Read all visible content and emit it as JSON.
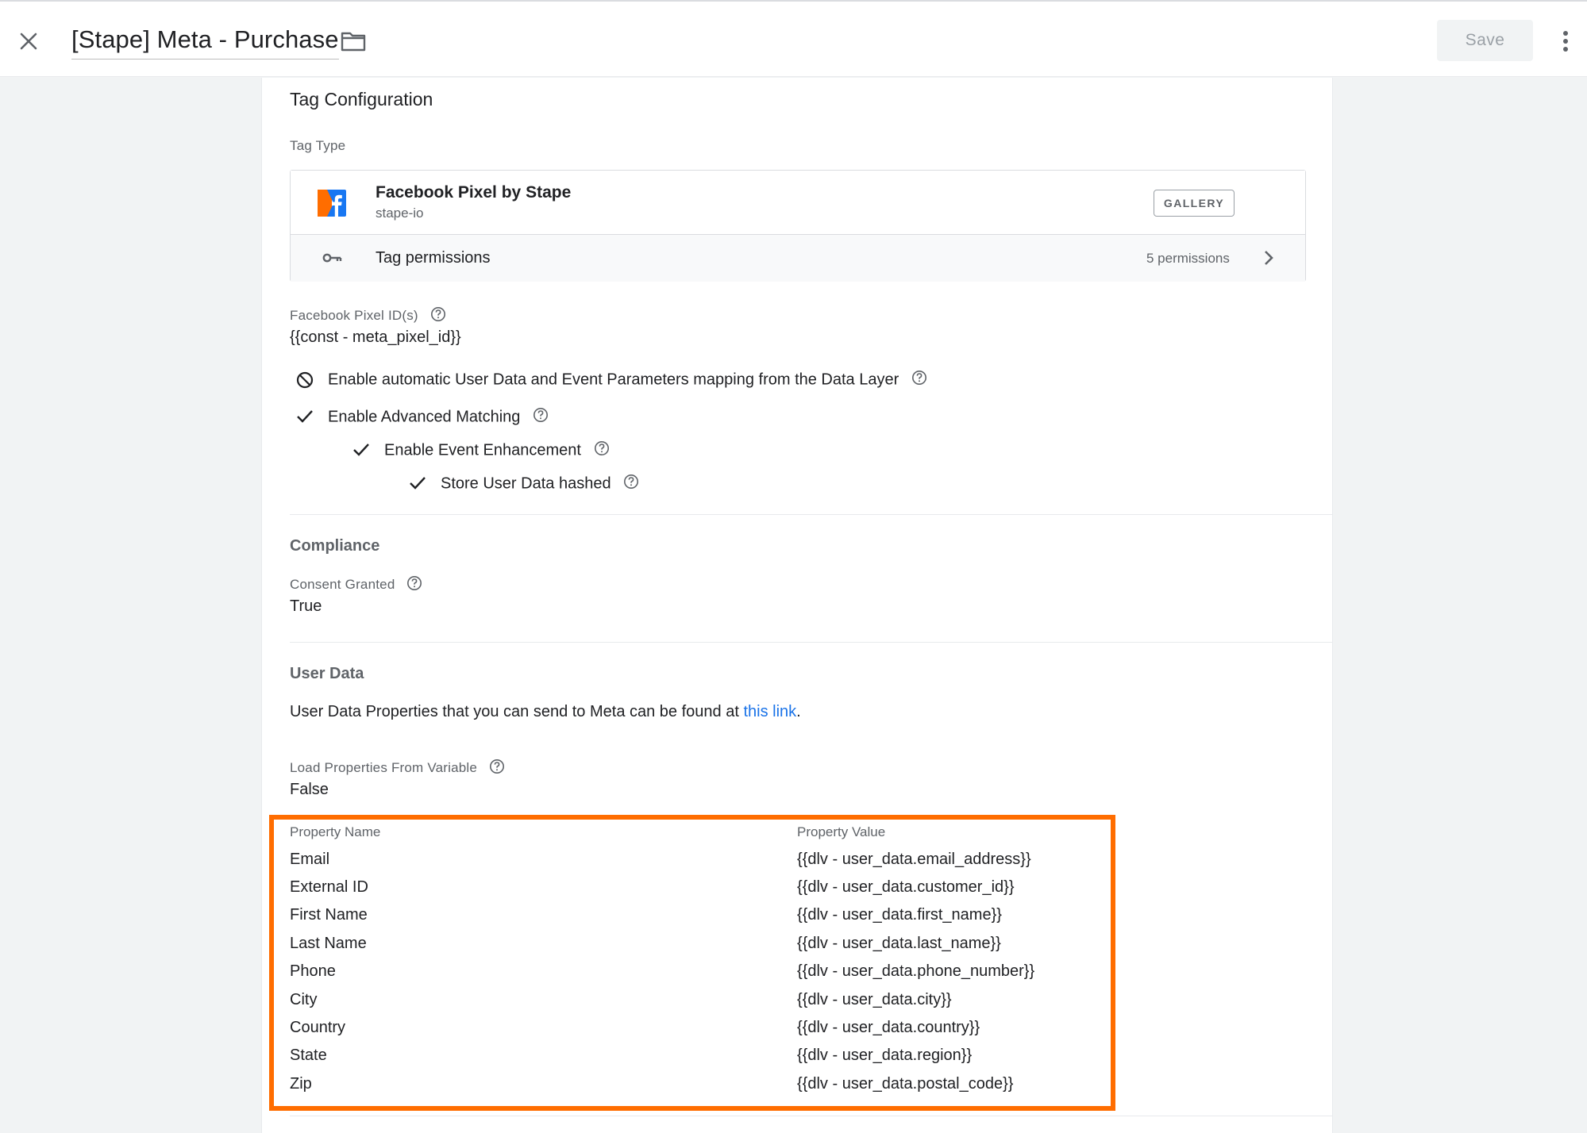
{
  "header": {
    "title": "[Stape] Meta - Purchase",
    "save_label": "Save"
  },
  "tag_configuration": {
    "section_title": "Tag Configuration",
    "tag_type_label": "Tag Type",
    "tag_type": {
      "name": "Facebook Pixel by Stape",
      "publisher": "stape-io",
      "gallery_label": "GALLERY",
      "icon_colors": {
        "orange": "#ff6d00",
        "blue": "#1877f2"
      }
    },
    "permissions": {
      "label": "Tag permissions",
      "count": "5 permissions"
    },
    "pixel_id": {
      "label": "Facebook Pixel ID(s)",
      "value": "{{const - meta_pixel_id}}"
    },
    "options": [
      {
        "label": "Enable automatic User Data and Event Parameters mapping from the Data Layer",
        "state": "disabled"
      },
      {
        "label": "Enable Advanced Matching",
        "state": "checked"
      },
      {
        "label": "Enable Event Enhancement",
        "state": "checked"
      },
      {
        "label": "Store User Data hashed",
        "state": "checked"
      }
    ]
  },
  "compliance": {
    "section_title": "Compliance",
    "consent_label": "Consent Granted",
    "consent_value": "True"
  },
  "user_data": {
    "section_title": "User Data",
    "description_prefix": "User Data Properties that you can send to Meta can be found at ",
    "link_text": "this link",
    "description_suffix": ".",
    "load_label": "Load Properties From Variable",
    "load_value": "False",
    "table": {
      "headers": [
        "Property Name",
        "Property Value"
      ],
      "rows": [
        {
          "name": "Email",
          "value": "{{dlv - user_data.email_address}}"
        },
        {
          "name": "External ID",
          "value": "{{dlv - user_data.customer_id}}"
        },
        {
          "name": "First Name",
          "value": "{{dlv - user_data.first_name}}"
        },
        {
          "name": "Last Name",
          "value": "{{dlv - user_data.last_name}}"
        },
        {
          "name": "Phone",
          "value": "{{dlv - user_data.phone_number}}"
        },
        {
          "name": "City",
          "value": "{{dlv - user_data.city}}"
        },
        {
          "name": "Country",
          "value": "{{dlv - user_data.country}}"
        },
        {
          "name": "State",
          "value": "{{dlv - user_data.region}}"
        },
        {
          "name": "Zip",
          "value": "{{dlv - user_data.postal_code}}"
        }
      ]
    },
    "highlight_color": "#ff6d00"
  }
}
